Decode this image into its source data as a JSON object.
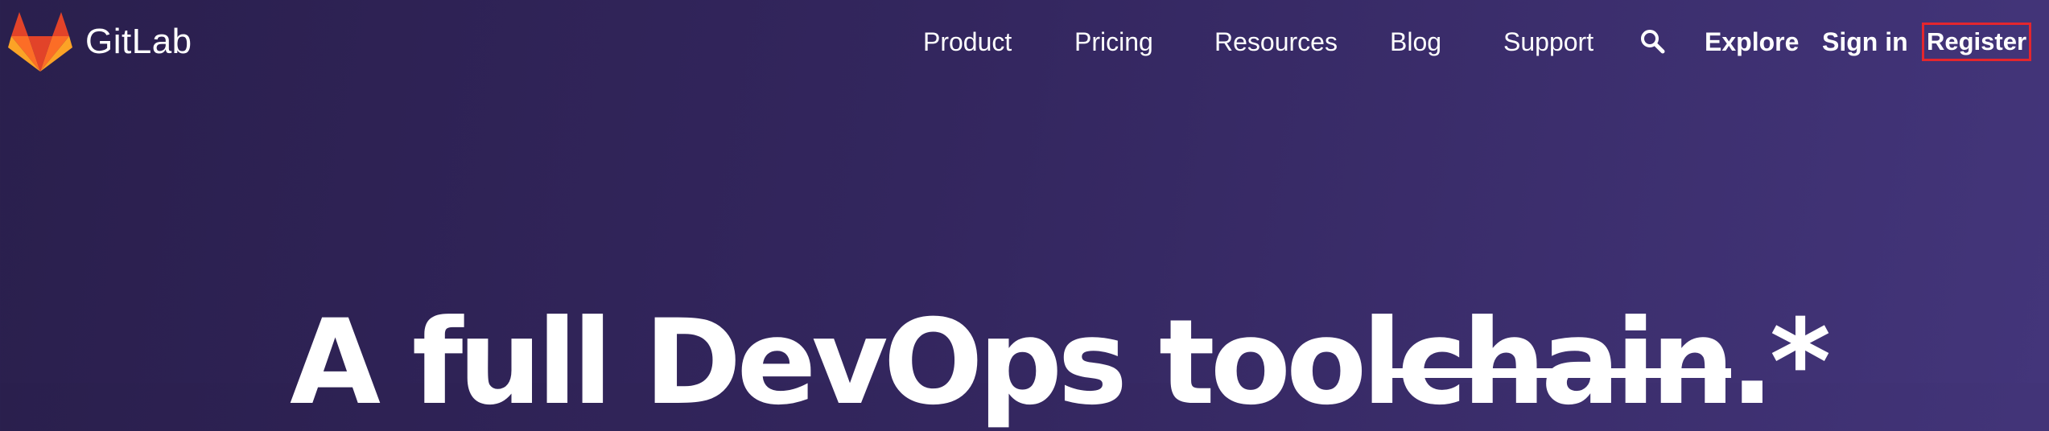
{
  "brand": {
    "name": "GitLab",
    "logo_icon": "gitlab-tanuki-icon",
    "logo_colors": [
      "#e24329",
      "#fc6d26",
      "#fca326"
    ]
  },
  "nav": {
    "items": [
      {
        "label": "Product"
      },
      {
        "label": "Pricing"
      },
      {
        "label": "Resources"
      },
      {
        "label": "Blog"
      },
      {
        "label": "Support"
      }
    ],
    "search_icon": "search-icon",
    "explore": "Explore",
    "sign_in": "Sign in",
    "register": "Register"
  },
  "hero": {
    "text_prefix": "A full DevOps tool",
    "struck_word": "chain",
    "suffix": ".*"
  },
  "colors": {
    "background_start": "#2a1f4d",
    "background_end": "#43357a",
    "register_outline": "#e4262d",
    "text": "#ffffff"
  }
}
